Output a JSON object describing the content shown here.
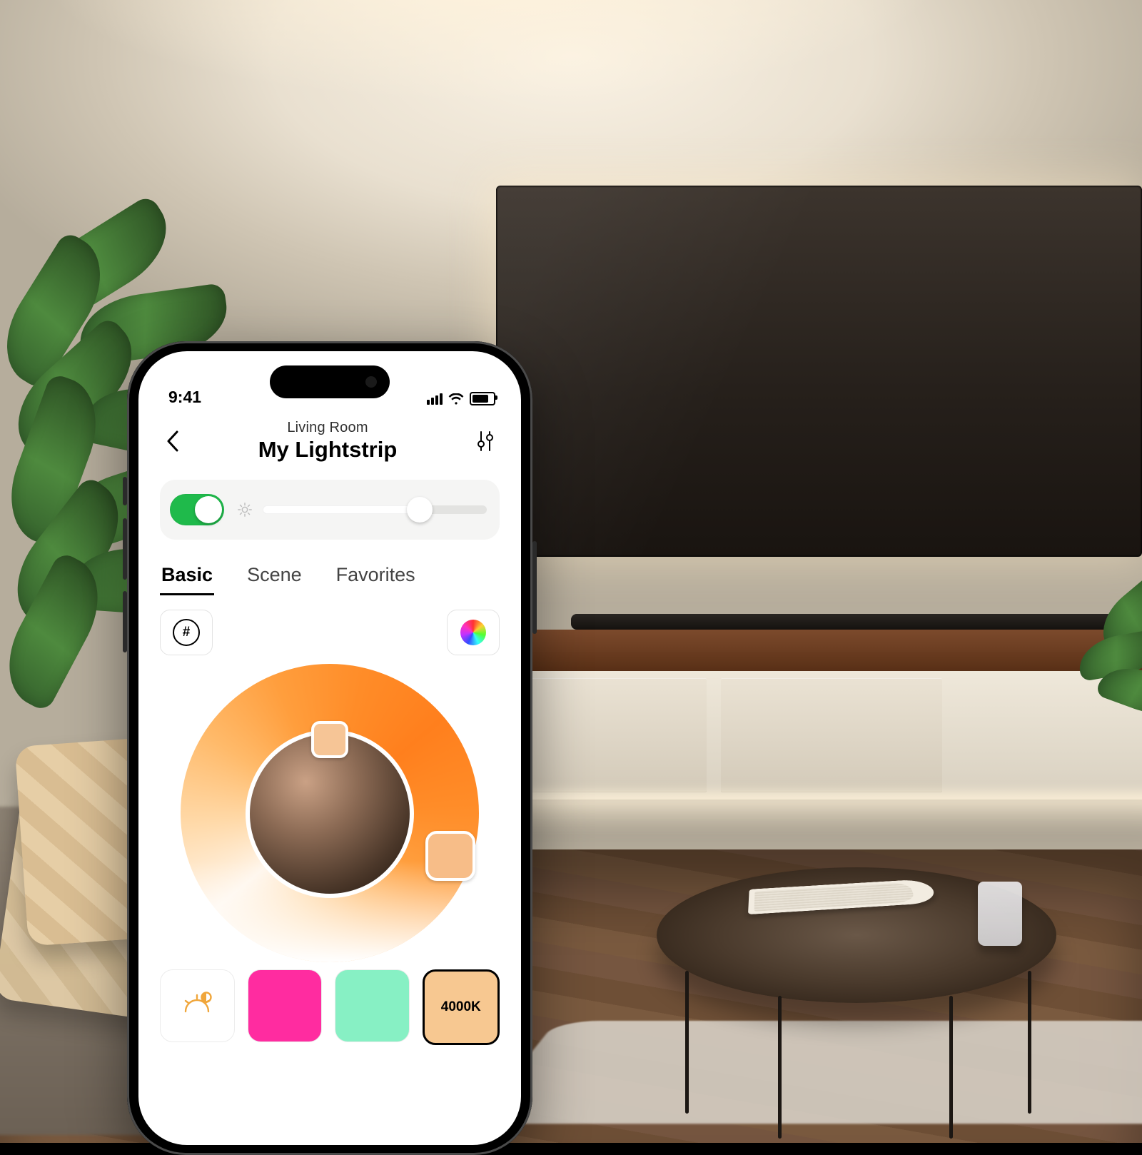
{
  "status": {
    "time": "9:41"
  },
  "header": {
    "room": "Living Room",
    "device": "My Lightstrip"
  },
  "controls": {
    "power_on": true,
    "brightness_percent": 70
  },
  "tabs": {
    "basic": "Basic",
    "scene": "Scene",
    "favorites": "Favorites",
    "active": "basic"
  },
  "tool_row": {
    "hex_glyph": "#"
  },
  "color_ring": {
    "inner_color": "#4c382a",
    "thumb_a_color": "#f6c596",
    "thumb_b_color": "#f7bd88"
  },
  "presets": {
    "swatch1_color": "#ff2ca0",
    "swatch2_color": "#87f0c4",
    "temperature_label": "4000K",
    "temperature_color": "#f7c891"
  }
}
